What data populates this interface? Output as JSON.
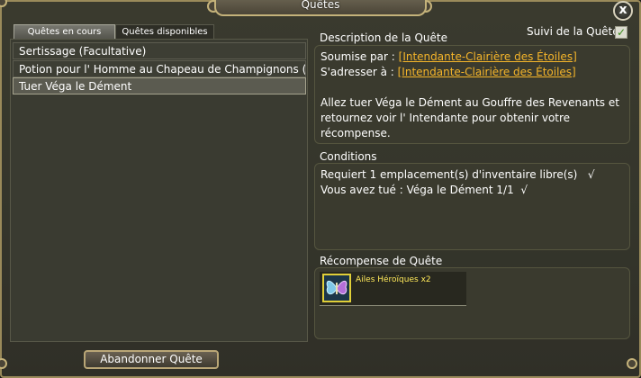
{
  "window": {
    "title": "Quêtes",
    "close_label": "x"
  },
  "tabs": {
    "active": "Quêtes en cours",
    "inactive": "Quêtes disponibles"
  },
  "quests": [
    "Sertissage (Facultative)",
    "Potion pour l' Homme au Chapeau de Champignons (Prin",
    "Tuer Véga le Dément"
  ],
  "abandon_label": "Abandonner Quête",
  "tracking": {
    "label": "Suivi de la Quête",
    "checked": true
  },
  "description": {
    "heading": "Description de la Quête",
    "submitted_by_label": "Soumise par :",
    "submitted_by": "[Intendante-Clairière des Étoiles]",
    "address_to_label": "S'adresser à :",
    "address_to": "[Intendante-Clairière des Étoiles]",
    "text_line1": "Allez tuer Véga le Dément au Gouffre des Revenants et",
    "text_line2": "retournez voir l' Intendante pour obtenir votre récompense."
  },
  "conditions": {
    "heading": "Conditions",
    "line1": "Requiert 1 emplacement(s) d'inventaire libre(s)",
    "line1_mark": "√",
    "line2": "Vous avez tué : Véga le Dément 1/1",
    "line2_mark": "√"
  },
  "reward": {
    "heading": "Récompense de Quête",
    "item_name": "Ailes Héroïques x2",
    "item_icon": "butterfly-wings-icon"
  },
  "colors": {
    "link": "#f5b52a",
    "reward_text": "#ffe95a",
    "frame": "#c4b27a"
  }
}
